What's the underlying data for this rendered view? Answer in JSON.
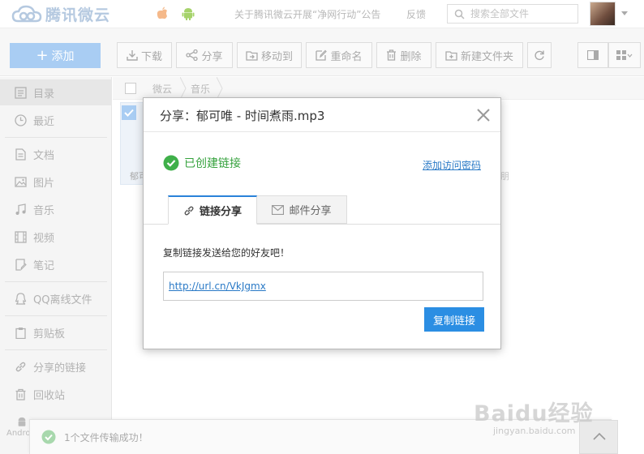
{
  "header": {
    "logo_text": "腾讯微云",
    "notice": "关于腾讯微云开展“净网行动”公告",
    "feedback": "反馈",
    "search_placeholder": "搜索全部文件"
  },
  "toolbar": {
    "add": "添加",
    "download": "下载",
    "share": "分享",
    "move_to": "移动到",
    "rename": "重命名",
    "delete": "删除",
    "new_folder": "新建文件夹"
  },
  "sidebar": {
    "items": [
      {
        "label": "目录",
        "icon": "directory-icon"
      },
      {
        "label": "最近",
        "icon": "clock-icon"
      },
      {
        "label": "文档",
        "icon": "document-icon"
      },
      {
        "label": "图片",
        "icon": "image-icon"
      },
      {
        "label": "音乐",
        "icon": "music-icon"
      },
      {
        "label": "视频",
        "icon": "video-icon"
      },
      {
        "label": "笔记",
        "icon": "note-icon"
      },
      {
        "label": "QQ离线文件",
        "icon": "qq-icon"
      },
      {
        "label": "剪贴板",
        "icon": "clipboard-icon"
      },
      {
        "label": "分享的链接",
        "icon": "link-icon"
      },
      {
        "label": "回收站",
        "icon": "trash-icon"
      }
    ],
    "android_label": "Android"
  },
  "breadcrumb": [
    "微云",
    "音乐"
  ],
  "file_fragment": "郁可",
  "right_fragment": "朋",
  "dialog": {
    "title": "分享：郁可唯 - 时间煮雨.mp3",
    "success": "已创建链接",
    "add_password": "添加访问密码",
    "tabs": [
      {
        "label": "链接分享",
        "active": true
      },
      {
        "label": "邮件分享",
        "active": false
      }
    ],
    "hint": "复制链接发送给您的好友吧！",
    "url": "http://url.cn/VkJgmx",
    "copy_button": "复制链接"
  },
  "toast": {
    "message": "1个文件传输成功！"
  },
  "watermark": {
    "text": "Baidu经验",
    "sub": "jingyan.baidu.com"
  },
  "colors": {
    "accent": "#2b8ee3",
    "success": "#35a23d",
    "link": "#2979c6"
  }
}
